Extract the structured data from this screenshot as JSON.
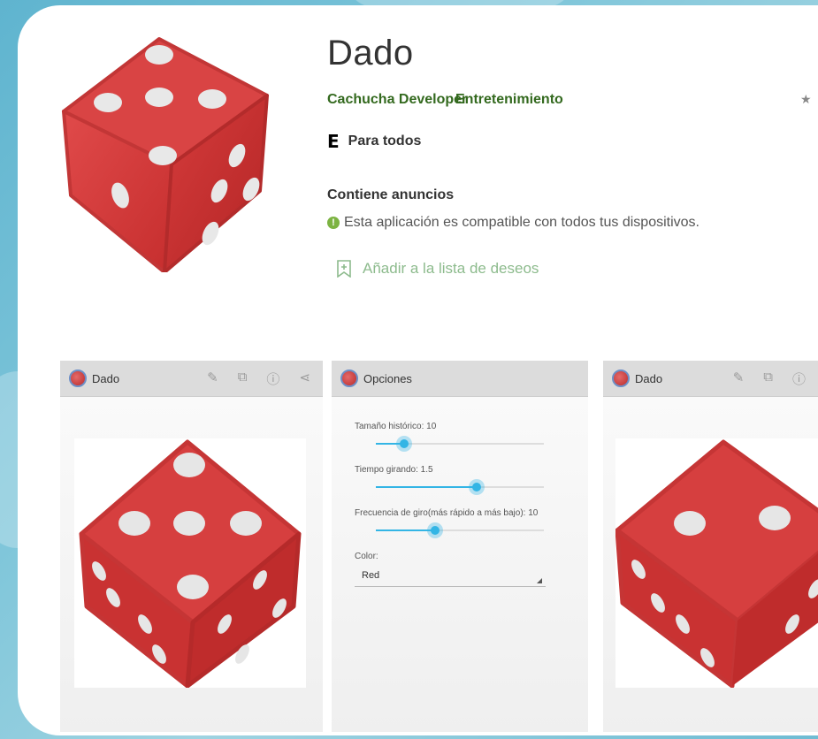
{
  "app": {
    "title": "Dado",
    "developer": "Cachucha Developer",
    "category": "Entretenimiento",
    "rating_label": "Para todos",
    "rating_icon": "E",
    "ads_label": "Contiene anuncios",
    "compat_text": "Esta aplicación es compatible con todos tus dispositivos.",
    "wishlist_label": "Añadir a la lista de deseos",
    "star": "★",
    "accent_green": "#33691e"
  },
  "screenshots": [
    {
      "bar_title": "Dado",
      "icons": [
        "wrench-icon",
        "history-icon",
        "info-icon",
        "share-icon"
      ]
    },
    {
      "bar_title": "Opciones",
      "settings": [
        {
          "label": "Tamaño histórico:  10",
          "level": 0.17
        },
        {
          "label": "Tiempo girando:  1.5",
          "level": 0.6
        },
        {
          "label": "Frecuencia de giro(más rápido a más bajo):  10",
          "level": 0.35
        }
      ],
      "color_label": "Color:",
      "color_value": "Red"
    },
    {
      "bar_title": "Dado",
      "icons": [
        "wrench-icon",
        "history-icon",
        "info-icon"
      ]
    }
  ]
}
